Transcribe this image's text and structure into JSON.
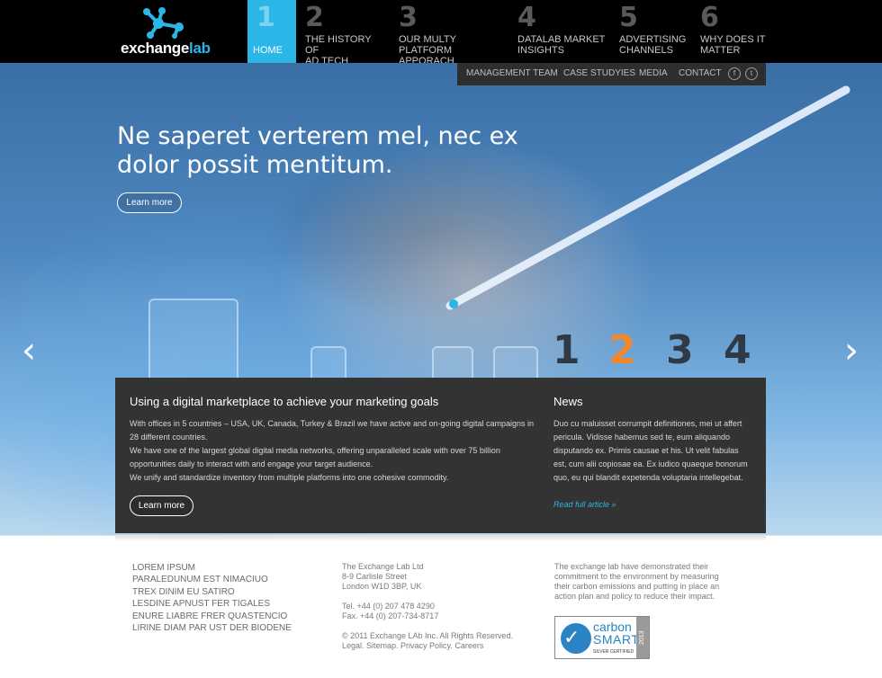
{
  "brand": {
    "name_main": "exchange",
    "name_accent": "lab",
    "accent_color": "#2bb6e8"
  },
  "nav": {
    "items": [
      {
        "num": "1",
        "label": "HOME"
      },
      {
        "num": "2",
        "label": "THE HISTORY OF\nAD TECH"
      },
      {
        "num": "3",
        "label": "OUR MULTY\nPLATFORM APPORACH"
      },
      {
        "num": "4",
        "label": "DATALAB MARKET\nINSIGHTS"
      },
      {
        "num": "5",
        "label": "ADVERTISING\nCHANNELS"
      },
      {
        "num": "6",
        "label": "WHY DOES IT\nMATTER"
      }
    ]
  },
  "subnav": {
    "items": [
      "MANAGEMENT TEAM",
      "CASE STUDYIES",
      "MEDIA",
      "CONTACT"
    ],
    "facebook_glyph": "f",
    "twitter_glyph": "t"
  },
  "hero": {
    "headline": "Ne saperet verterem mel, nec ex dolor possit mentitum.",
    "cta": "Learn more",
    "slides": [
      "1",
      "2",
      "3",
      "4"
    ],
    "active_slide": 2,
    "prev_glyph": "‹",
    "next_glyph": "›"
  },
  "panel": {
    "title": "Using a digital marketplace to achieve your marketing goals",
    "paragraphs": [
      "With offices in 5 countries – USA, UK, Canada, Turkey & Brazil we have active and on-going digital campaigns in 28 different countries.",
      "We have one of the largest global digital media networks, offering unparalleled scale with over 75 billion opportunities daily to interact with and engage your target audience.",
      "We unify and standardize inventory from multiple platforms into one cohesive commodity."
    ],
    "cta": "Learn more",
    "news_title": "News",
    "news_body": "Duo cu maluisset corrumpit definitiones, mei ut affert pericula. Vidisse habemus sed te, eum aliquando disputando ex. Primis causae et his. Ut velit fabulas est, cum alii copiosae ea. Ex iudico quaeque bonorum quo, eu qui blandit expetenda voluptaria intellegebat.",
    "read_more": "Read full article »"
  },
  "footer": {
    "links": [
      "LOREM IPSUM",
      "PARALEDUNUM EST NIMACIUO",
      "TREX DINIM EU SATIRO",
      "LESDINE APNUST FER TIGALES",
      "ENURE LIABRE FRER QUASTENCIO",
      "LIRINE DIAM PAR UST DER BIODENE"
    ],
    "company": "The Exchange Lab Ltd",
    "address1": "8-9 Carlisle Street",
    "address2": "London W1D 3BP, UK",
    "tel": "Tel. +44 (0) 207 478 4290",
    "fax": "Fax. +44 (0) 207-734-8717",
    "copyright": "© 2011 Exchange LAb Inc. All Rights Reserved.",
    "legal_links": "Legal. Sitemap. Privacy Policy. Careers",
    "eco_text": "The exchange lab have demonstrated their commitment to the environment by measuring their carbon emissions and putting in place an action plan and policy to reduce their impact.",
    "badge": {
      "line1": "carbon",
      "line2": "SMART",
      "line3": "SILVER CERTIFIED",
      "year": "2013"
    }
  }
}
